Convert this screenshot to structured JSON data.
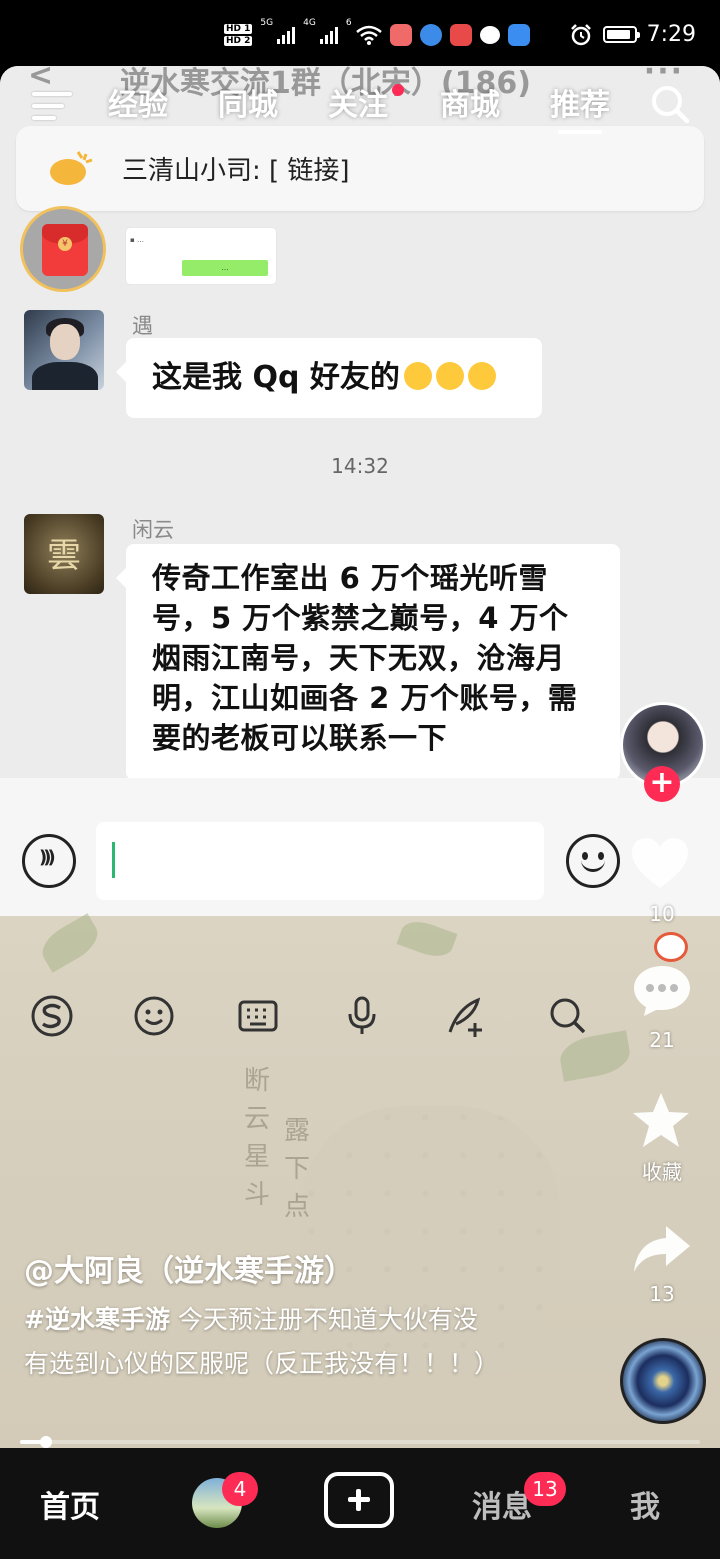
{
  "status_bar": {
    "hd1": "HD 1",
    "hd2": "HD 2",
    "net1": "5G",
    "net2": "4G",
    "wifi": "6",
    "time": "7:29"
  },
  "chat": {
    "title_back": "<",
    "title": "逆水寒交流1群（北宋）(186)",
    "title_more": "···",
    "pinned_notice": "三清山小司: [ 链接]",
    "messages": [
      {
        "sender": "遇",
        "text": "这是我 Qq 好友的"
      },
      {
        "sender": "闲云",
        "text": "传奇工作室出 6 万个瑶光听雪号，5 万个紫禁之巅号，4 万个烟雨江南号，天下无双，沧海月明，江山如画各 2 万个账号，需要的老板可以联系一下"
      }
    ],
    "timestamp": "14:32",
    "avatar_glyph": "雲"
  },
  "top_nav": {
    "tabs": [
      "经验",
      "同城",
      "关注",
      "商城",
      "推荐"
    ],
    "active_tab": "推荐"
  },
  "video": {
    "author": "@大阿良（逆水寒手游）",
    "hashtag": "#逆水寒手游",
    "description": " 今天预注册不知道大伙有没有选到心仪的区服呢（反正我没有！！！）",
    "progress": 0.035,
    "like_count": "10",
    "comment_count": "21",
    "favorite_label": "收藏",
    "share_count": "13",
    "overlay_text_1": "断云星斗",
    "overlay_text_2": "露下点",
    "follow_plus": "+"
  },
  "bottom_nav": {
    "home": "首页",
    "friends_badge": "4",
    "messages": "消息",
    "messages_badge": "13",
    "me": "我"
  },
  "colors": {
    "accent": "#fe2c55",
    "bubble_green": "#95ec69",
    "chat_bg": "#ececec"
  }
}
